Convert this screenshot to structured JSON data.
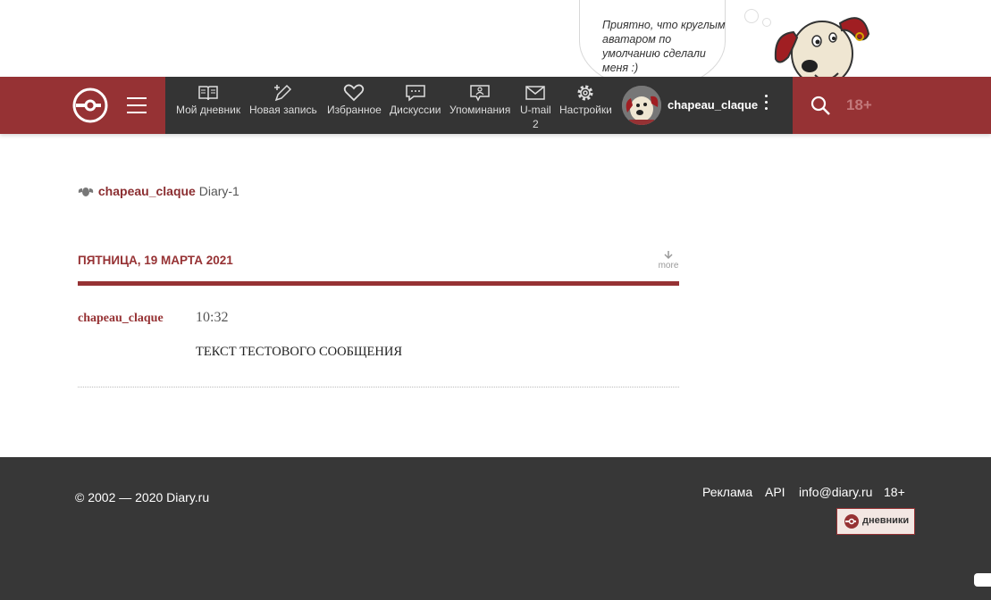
{
  "mascot": {
    "bubble_text": "Приятно, что круглым аватаром по умолчанию сделали меня :)"
  },
  "header": {
    "nav_items": [
      {
        "label": "Мой дневник",
        "icon": "book-icon"
      },
      {
        "label": "Новая запись",
        "icon": "pen-icon"
      },
      {
        "label": "Избранное",
        "icon": "heart-icon"
      },
      {
        "label": "Дискуссии",
        "icon": "chat-icon"
      },
      {
        "label": "Упоминания",
        "icon": "mention-icon"
      },
      {
        "label": "U-mail",
        "icon": "mail-icon",
        "count": "2"
      },
      {
        "label": "Настройки",
        "icon": "gear-icon"
      }
    ],
    "username": "chapeau_claque",
    "age_label": "18+"
  },
  "breadcrumb": {
    "user": "chapeau_claque",
    "diary": "Diary-1"
  },
  "day": {
    "title": "ПЯТНИЦА, 19 МАРТА 2021",
    "more_label": "more"
  },
  "post": {
    "author": "chapeau_claque",
    "time": "10:32",
    "text": "ТЕКСТ ТЕСТОВОГО СООБЩЕНИЯ"
  },
  "footer": {
    "copyright": "© 2002 — 2020 Diary.ru",
    "links": [
      "Реклама",
      "API",
      "info@diary.ru",
      "18+"
    ],
    "badge_label": "дневники"
  },
  "colors": {
    "brand": "#963234",
    "nav_bg": "#343434",
    "footer_bg": "#373737"
  }
}
